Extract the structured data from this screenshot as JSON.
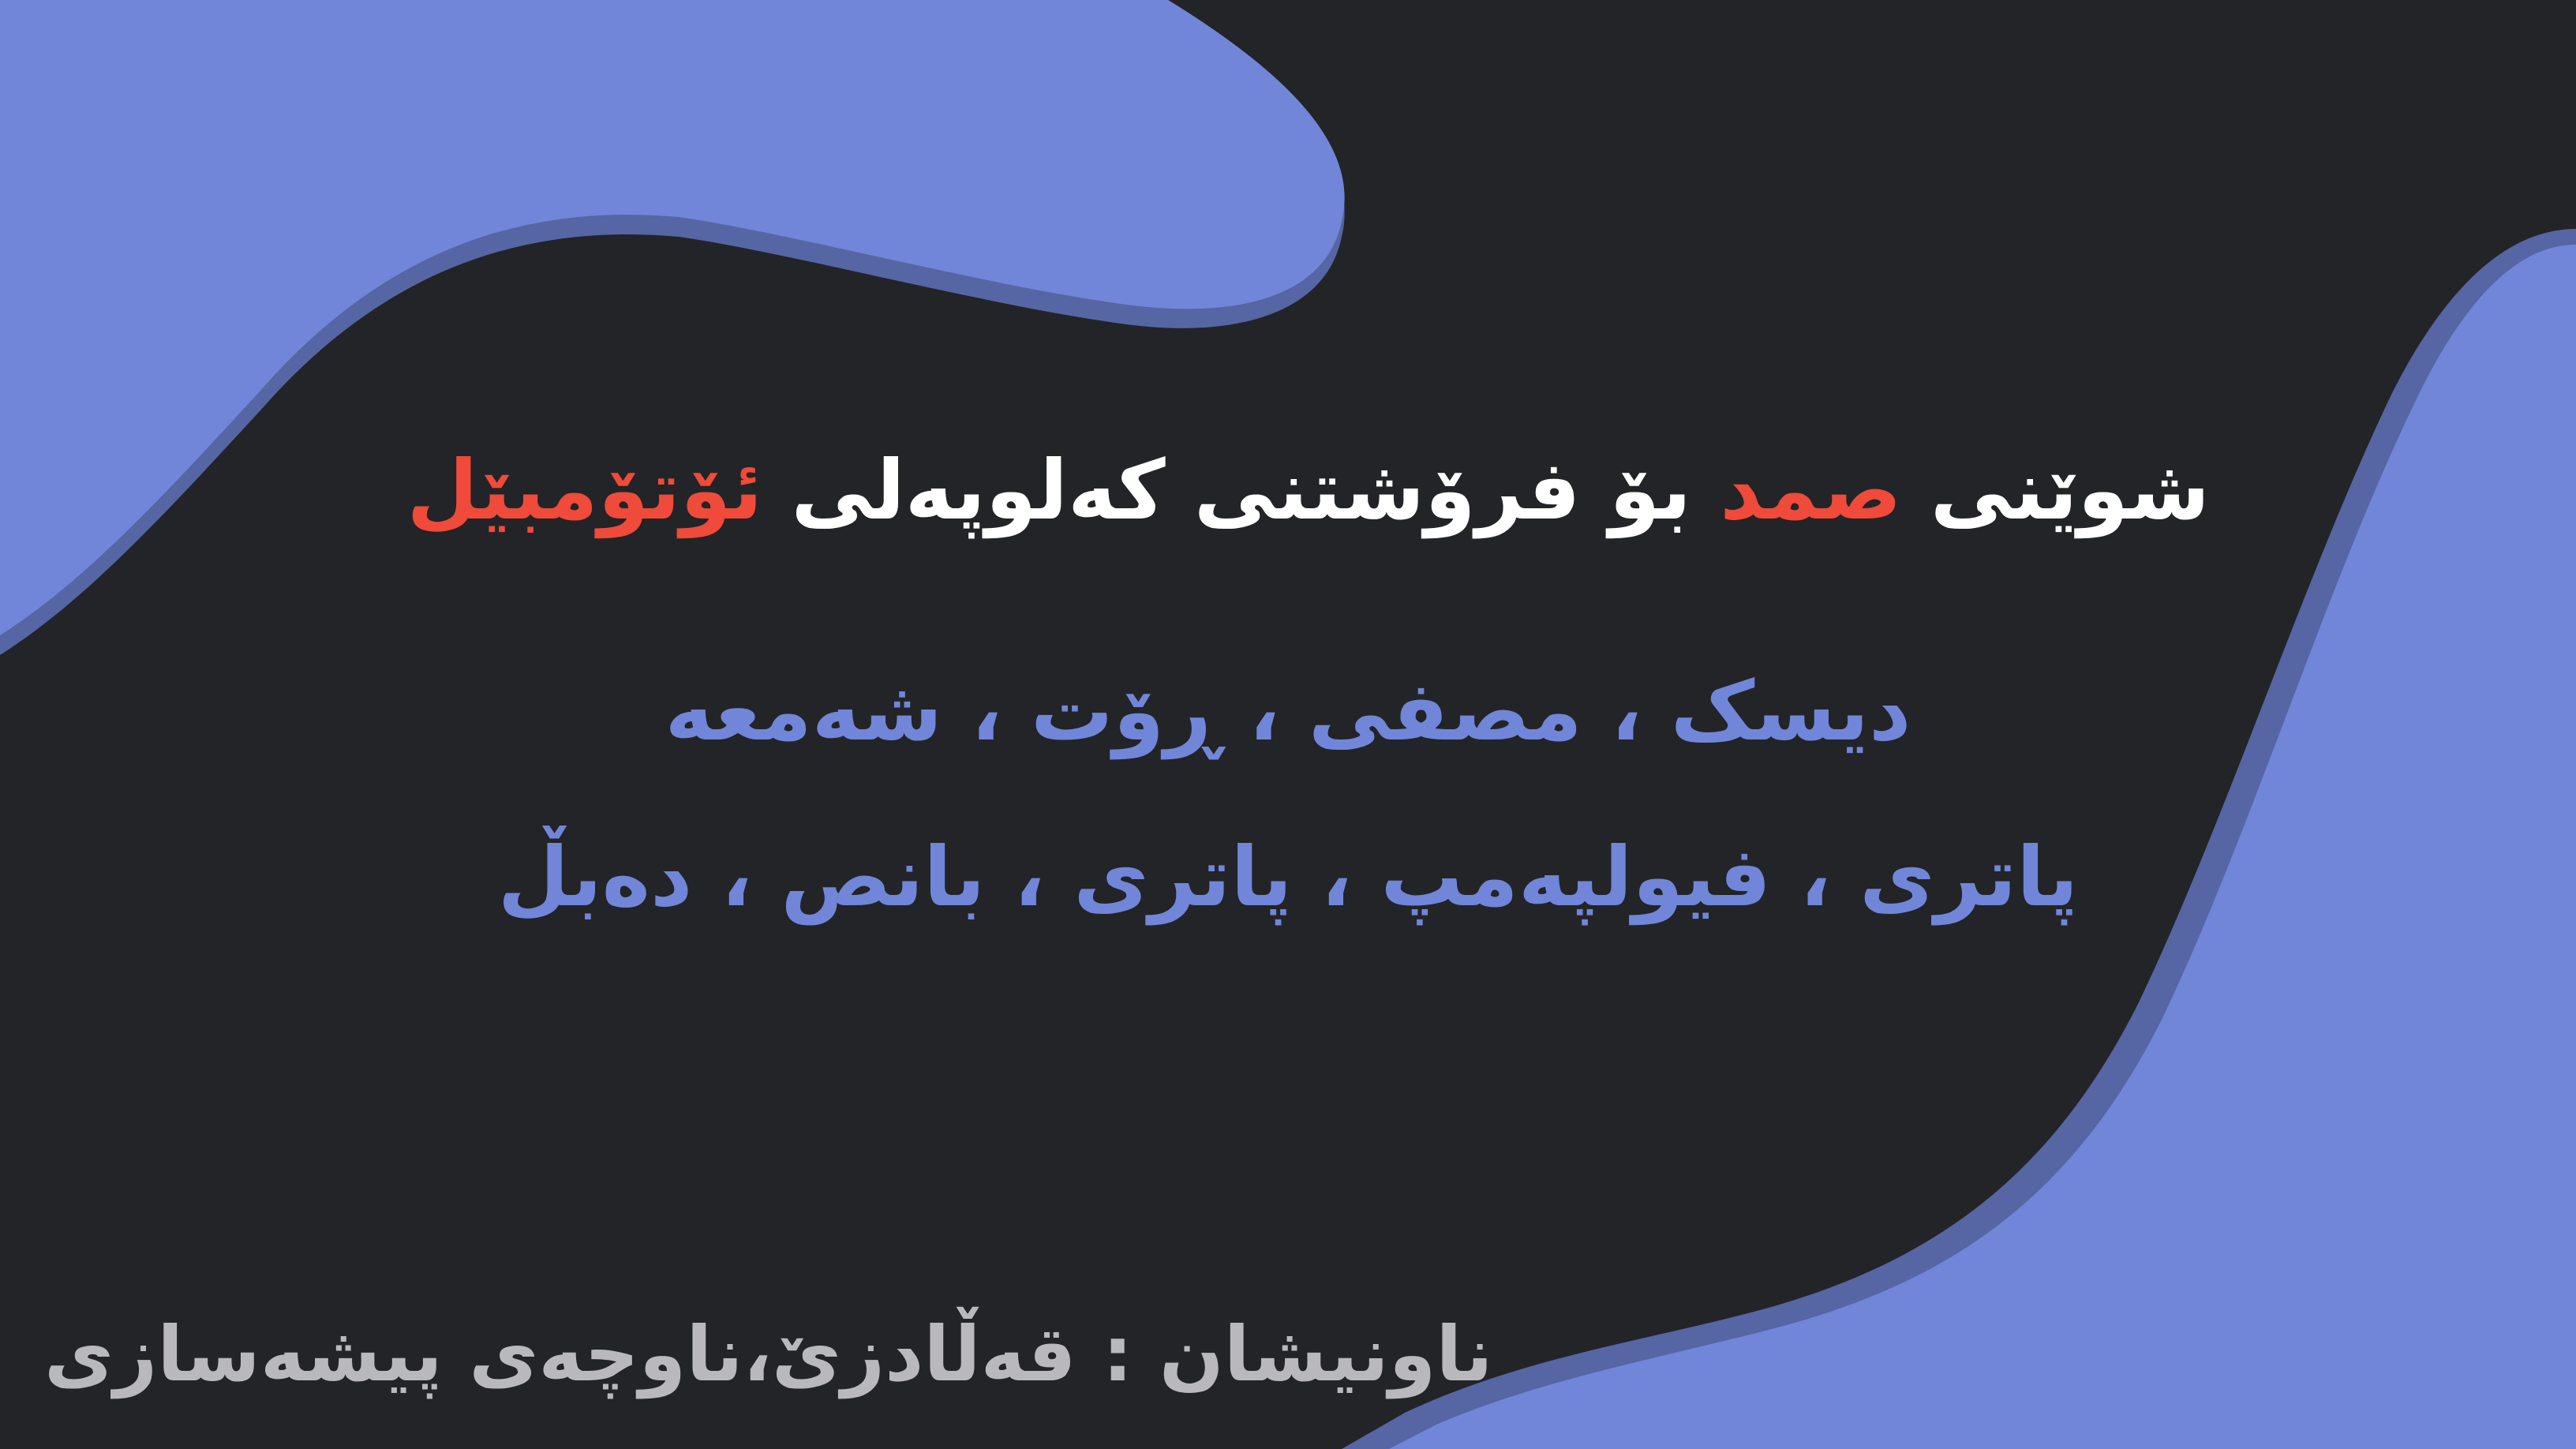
{
  "headline": {
    "part1": "شوێنی ",
    "brand": "صمد",
    "part2": " بۆ فرۆشتنی کەلوپەلی ",
    "product": "ئۆتۆمبێل"
  },
  "items_line1": "دیسک ، مصفی ، ڕۆت ، شەمعە",
  "items_line2": "پاتری ، فیولپەمپ ، پاتری ، بانص ، دەبڵ",
  "address": "ناونیشان : قەڵادزێ،ناوچەی پیشەسازی",
  "colors": {
    "background": "#222427",
    "accent_blue": "#7186d8",
    "shadow_blue": "#5665a3",
    "highlight_red": "#ef4a3a",
    "white": "#ffffff",
    "gray": "#b9b9bd"
  }
}
